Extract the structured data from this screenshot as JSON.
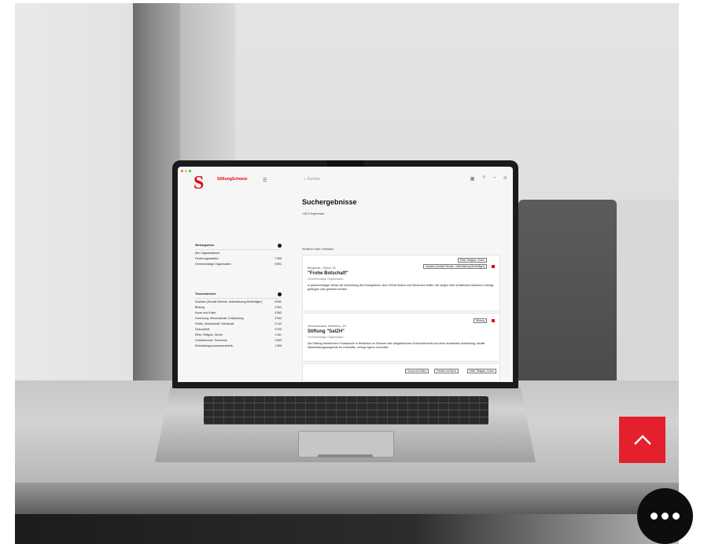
{
  "photo": {
    "description_colors": {
      "accent": "#e30613",
      "button_red": "#e4202d",
      "button_dark": "#0d0d0d"
    }
  },
  "screen": {
    "brand": "StiftungSchweiz",
    "search_placeholder": "Suchen",
    "title": "Suchergebnisse",
    "result_count": "14574 Ergebnisse",
    "filters": {
      "wirkungsform": {
        "label": "Wirkungsform",
        "items": [
          {
            "label": "Alle Organisationen",
            "count": ""
          },
          {
            "label": "Förderorganisation",
            "count": "7'455"
          },
          {
            "label": "Gemeinnützige Organisation",
            "count": "6'994"
          }
        ]
      },
      "themenbereich": {
        "label": "Themenbereich",
        "items": [
          {
            "label": "Soziales (Soziale Dienste, Unterstützung Bedürftiger)",
            "count": "6'990"
          },
          {
            "label": "Bildung",
            "count": "4'303"
          },
          {
            "label": "Kunst und Kultur",
            "count": "4'363"
          },
          {
            "label": "Forschung, Wissenschaft, Entwicklung",
            "count": "2'944"
          },
          {
            "label": "Politik, Gesellschaft, Wirtschaft",
            "count": "2'140"
          },
          {
            "label": "Gesundheit",
            "count": "2'109"
          },
          {
            "label": "Ethik, Religion, Kirche",
            "count": "1'161"
          },
          {
            "label": "Umweltschutz, Tierschutz",
            "count": "1'563"
          },
          {
            "label": "Entwicklungszusammenarbeit,",
            "count": "1'455"
          }
        ]
      }
    },
    "sort_label": "Sortieren nach: Relevanz",
    "results": [
      {
        "location": "Bürglenstr., Glarus, GL",
        "name": "\"Frohe Botschaft\"",
        "type": "Gemeinnützige Organisation",
        "description": "In gemeinnütziger Weise die Verbreitung des Evangeliums Jesu Christi fördern und Menschen helfen, die wegen ihres christlichen Glaubens verfolgt, gefangen oder gefoltert werden.",
        "tags": [
          "Ethik, Religion, Kirche",
          "Soziales (Soziale Dienste, Unterstützung Bedürftiger)"
        ]
      },
      {
        "location": "Zürcherstrasse, Winterthur, ZH",
        "name": "Stiftung \"SalZH\"",
        "type": "Gemeinnützige Organisation",
        "description": "Die Stiftung betreibt eine Privatschule in Winterthur im Rahmen des obligatorischen Schulunterrichts und einer erweiterten Ausbildung, schafft Weiterbildungsangebote für Lehrkräfte, verlegt eigene Lehrmittel.",
        "tags": [
          "Bildung"
        ]
      },
      {
        "tags": [
          "Kunst und Kultur",
          "Freizeit und Sport",
          "Ethik, Religion, Kirche"
        ]
      }
    ]
  },
  "overlays": {
    "scroll_top_icon": "chevron-up-icon",
    "more_icon": "more-dots-icon"
  }
}
